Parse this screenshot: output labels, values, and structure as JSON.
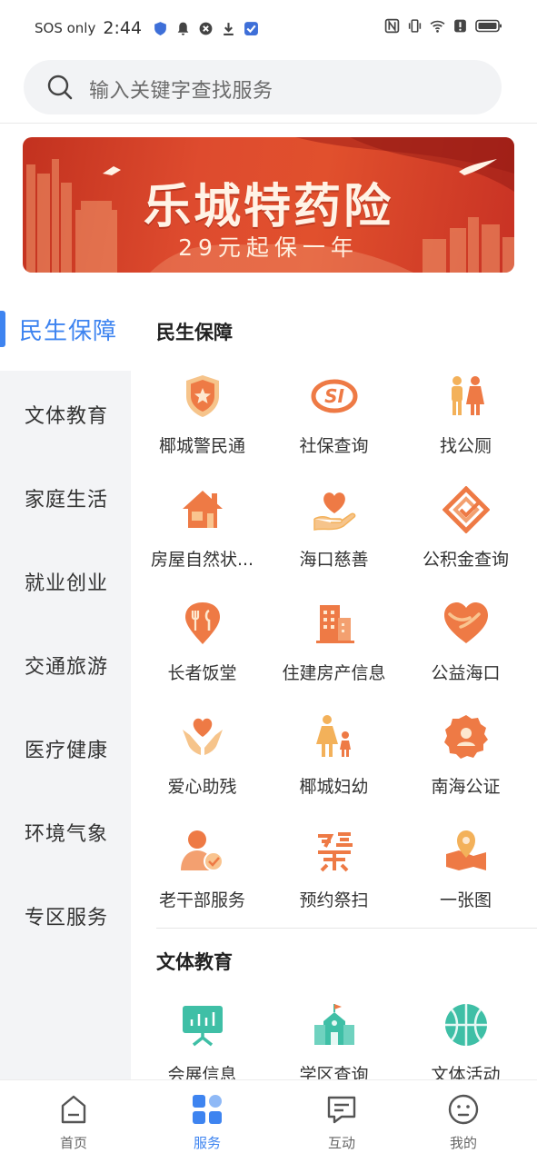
{
  "status_bar": {
    "carrier": "SOS only",
    "time": "2:44"
  },
  "search": {
    "placeholder": "输入关键字查找服务"
  },
  "banner": {
    "title": "乐城特药险",
    "subtitle": "29元起保一年"
  },
  "sidebar": {
    "active_index": 0,
    "items": [
      {
        "label": "民生保障"
      },
      {
        "label": "文体教育"
      },
      {
        "label": "家庭生活"
      },
      {
        "label": "就业创业"
      },
      {
        "label": "交通旅游"
      },
      {
        "label": "医疗健康"
      },
      {
        "label": "环境气象"
      },
      {
        "label": "专区服务"
      }
    ]
  },
  "sections": [
    {
      "title": "民生保障",
      "items": [
        {
          "label": "椰城警民通",
          "icon": "police-badge-icon"
        },
        {
          "label": "社保查询",
          "icon": "social-security-icon"
        },
        {
          "label": "找公厕",
          "icon": "restroom-icon"
        },
        {
          "label": "房屋自然状...",
          "icon": "house-icon"
        },
        {
          "label": "海口慈善",
          "icon": "charity-heart-hand-icon"
        },
        {
          "label": "公积金查询",
          "icon": "housing-fund-icon"
        },
        {
          "label": "长者饭堂",
          "icon": "canteen-icon"
        },
        {
          "label": "住建房产信息",
          "icon": "building-icon"
        },
        {
          "label": "公益海口",
          "icon": "public-welfare-heart-icon"
        },
        {
          "label": "爱心助残",
          "icon": "caring-hands-icon"
        },
        {
          "label": "椰城妇幼",
          "icon": "mother-child-icon"
        },
        {
          "label": "南海公证",
          "icon": "notary-seal-icon"
        },
        {
          "label": "老干部服务",
          "icon": "veteran-cadre-icon"
        },
        {
          "label": "预约祭扫",
          "icon": "tomb-sweeping-icon"
        },
        {
          "label": "一张图",
          "icon": "map-pin-icon"
        }
      ]
    },
    {
      "title": "文体教育",
      "items": [
        {
          "label": "会展信息",
          "icon": "exhibition-board-icon"
        },
        {
          "label": "学区查询",
          "icon": "school-icon"
        },
        {
          "label": "文体活动",
          "icon": "basketball-icon"
        }
      ]
    }
  ],
  "tabbar": {
    "active_index": 1,
    "items": [
      {
        "label": "首页",
        "icon": "home-icon"
      },
      {
        "label": "服务",
        "icon": "services-grid-icon"
      },
      {
        "label": "互动",
        "icon": "chat-icon"
      },
      {
        "label": "我的",
        "icon": "profile-face-icon"
      }
    ]
  },
  "colors": {
    "accent": "#3e84f0",
    "icon_orange": "#ee7a45",
    "icon_teal": "#3fbfa6",
    "banner_red": "#d8442b"
  }
}
